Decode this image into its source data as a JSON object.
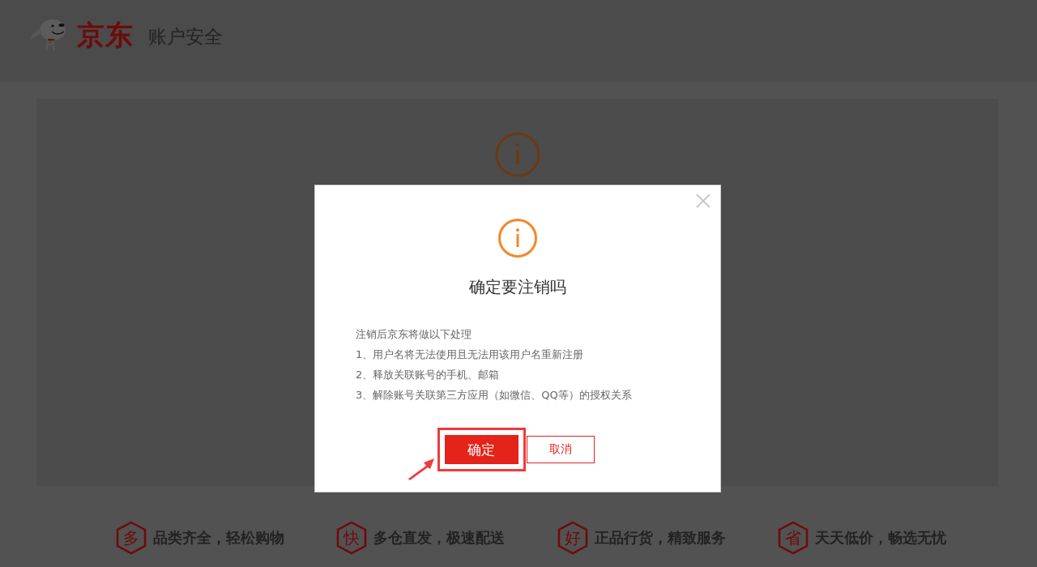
{
  "header": {
    "logo_text": "京东",
    "title": "账户安全"
  },
  "dialog": {
    "title": "确定要注销吗",
    "intro": "注销后京东将做以下处理",
    "items": [
      "1、用户名将无法使用且无法用该用户名重新注册",
      "2、释放关联账号的手机、邮箱",
      "3、解除账号关联第三方应用（如微信、QQ等）的授权关系"
    ],
    "buttons": [
      {
        "label": "确定",
        "kind": "primary",
        "highlighted": true
      },
      {
        "label": "取消",
        "kind": "secondary",
        "highlighted": false
      }
    ]
  },
  "features": [
    {
      "badge": "多",
      "text": "品类齐全，轻松购物"
    },
    {
      "badge": "快",
      "text": "多仓直发，极速配送"
    },
    {
      "badge": "好",
      "text": "正品行货，精致服务"
    },
    {
      "badge": "省",
      "text": "天天低价，畅选无忧"
    }
  ]
}
